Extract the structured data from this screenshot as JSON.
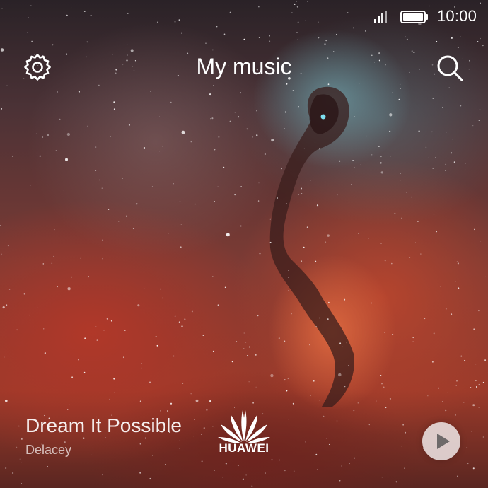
{
  "status_bar": {
    "time": "10:00",
    "icons": [
      "signal-icon",
      "battery-icon"
    ]
  },
  "header": {
    "title": "My music",
    "left_icon": "gear-icon",
    "right_icon": "search-icon"
  },
  "now_playing": {
    "song_title": "Dream It Possible",
    "artist": "Delacey",
    "play_icon": "play-icon"
  },
  "branding": {
    "logo_text": "HUAWEI"
  },
  "colors": {
    "text": "#ffffff",
    "play_button_bg": "#ebe1e1",
    "play_icon": "#6e6a6a"
  }
}
